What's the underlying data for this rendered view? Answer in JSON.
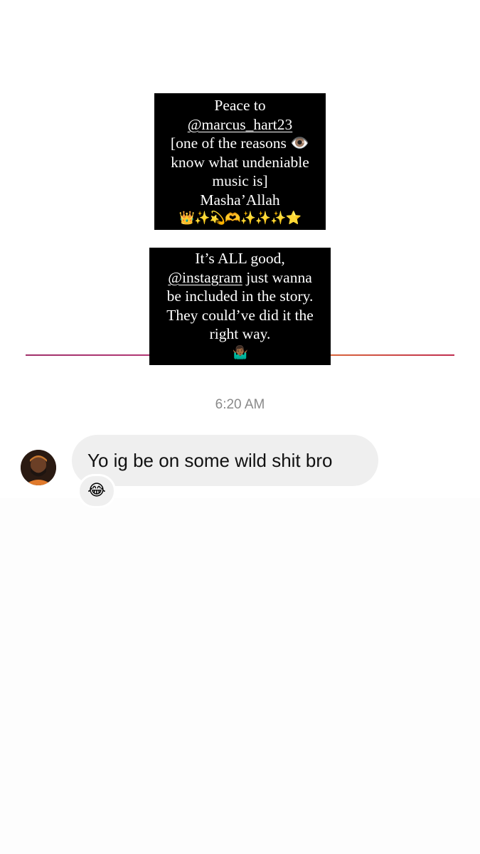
{
  "story_reply_1": {
    "lines": [
      "Peace to",
      "@marcus_hart23",
      "[one of the reasons 👁️",
      "know what undeniable",
      "music is]",
      "Masha’Allah",
      "👑✨💫🫶✨✨✨⭐️"
    ]
  },
  "story_reply_2": {
    "lines": [
      "It’s ALL good,",
      "@instagram",
      " just wanna",
      "be included in the story.",
      "They could’ve did it the",
      "right way.",
      "🤷🏾‍♂️"
    ]
  },
  "conversation": {
    "timestamp": "6:20 AM",
    "message": {
      "text": "Yo ig be on some wild shit bro",
      "reaction_emoji": "😂"
    }
  },
  "colors": {
    "bubble": "#efefef",
    "timestamp": "#8a8a8a",
    "gradient_start": "#a0306a",
    "gradient_end": "#d9663a"
  }
}
